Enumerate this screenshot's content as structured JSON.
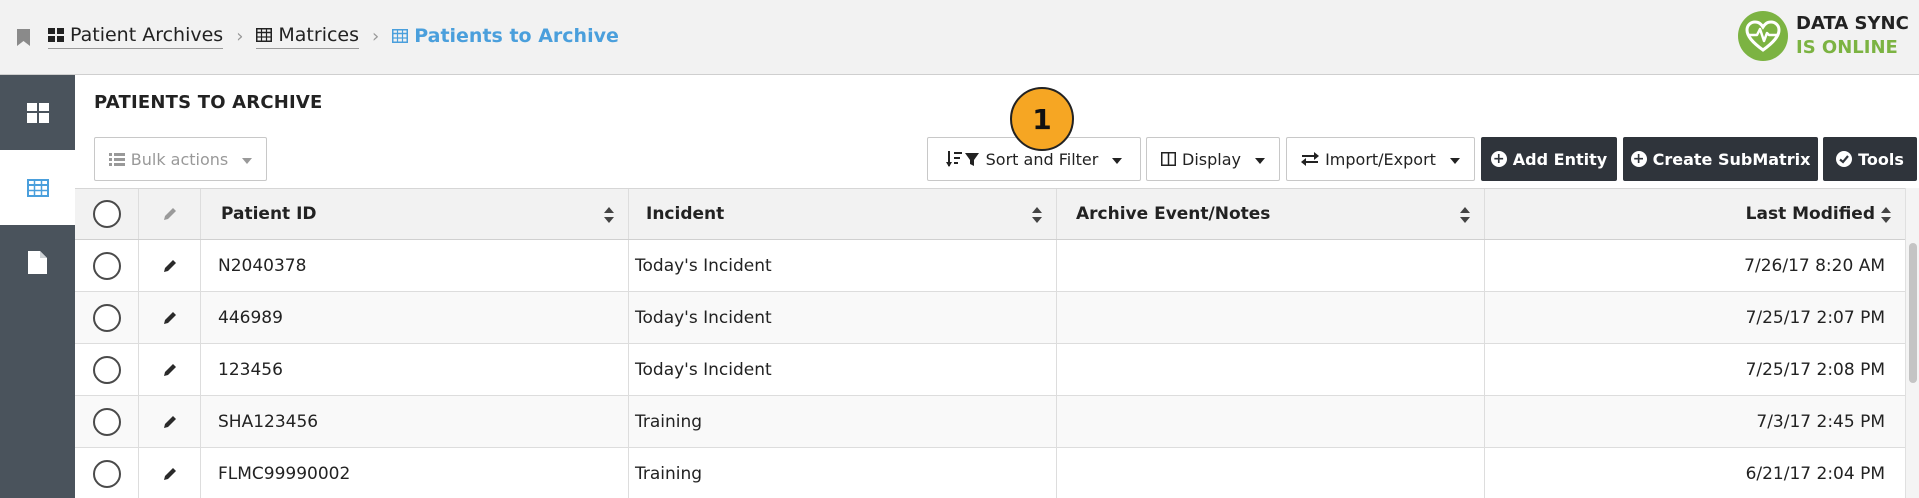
{
  "breadcrumb": {
    "items": [
      {
        "label": "Patient Archives",
        "icon": "dashboard-icon"
      },
      {
        "label": "Matrices",
        "icon": "table-icon"
      },
      {
        "label": "Patients to Archive",
        "icon": "table-icon",
        "active": true
      }
    ]
  },
  "sync": {
    "line1": "DATA SYNC",
    "line2": "IS ONLINE",
    "color": "#7cb342"
  },
  "sidebar": {
    "items": [
      {
        "name": "dashboard",
        "icon": "dashboard-icon"
      },
      {
        "name": "matrices",
        "icon": "table-icon",
        "active": true
      },
      {
        "name": "documents",
        "icon": "document-icon"
      }
    ]
  },
  "page": {
    "title": "PATIENTS TO ARCHIVE"
  },
  "toolbar": {
    "bulk_actions": "Bulk actions",
    "sort_filter": "Sort and Filter",
    "display": "Display",
    "import_export": "Import/Export",
    "add_entity": "Add Entity",
    "create_submatrix": "Create SubMatrix",
    "tools": "Tools"
  },
  "annotation": {
    "number": "1",
    "color": "#f6a623"
  },
  "table": {
    "columns": [
      "Patient ID",
      "Incident",
      "Archive Event/Notes",
      "Last Modified"
    ],
    "rows": [
      {
        "patient_id": "N2040378",
        "incident": "Today's Incident",
        "notes": "",
        "modified": "7/26/17 8:20 AM"
      },
      {
        "patient_id": "446989",
        "incident": "Today's Incident",
        "notes": "",
        "modified": "7/25/17 2:07 PM"
      },
      {
        "patient_id": "123456",
        "incident": "Today's Incident",
        "notes": "",
        "modified": "7/25/17 2:08 PM"
      },
      {
        "patient_id": "SHA123456",
        "incident": "Training",
        "notes": "",
        "modified": "7/3/17 2:45 PM"
      },
      {
        "patient_id": "FLMC99990002",
        "incident": "Training",
        "notes": "",
        "modified": "6/21/17 2:04 PM"
      }
    ]
  },
  "colors": {
    "accent": "#4a9fdc",
    "sidebar": "#4a535c",
    "dark_button": "#2f343b",
    "online": "#7cb342"
  }
}
